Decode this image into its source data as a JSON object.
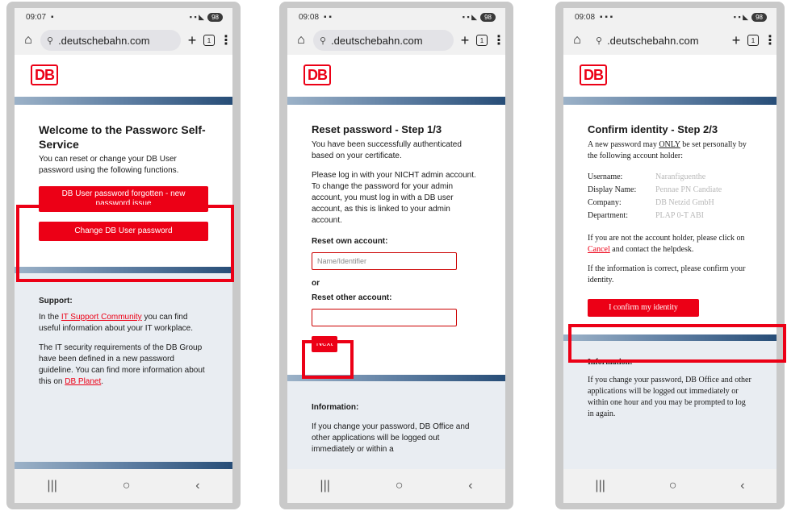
{
  "colors": {
    "brand_red": "#ec0016",
    "band_dark": "#274d77",
    "panel_grey": "#e9edf2"
  },
  "phones": [
    {
      "status": {
        "time": "09:07",
        "battery": "98"
      },
      "url": ".deutschebahn.com",
      "tab_count": "1",
      "title": "Welcome to the Passworc Self-Service",
      "intro": "You can reset or change your DB User password using the following functions.",
      "btn_forgot": "DB User password forgotten - new password issue",
      "btn_change": "Change DB User password",
      "support_title": "Support:",
      "support_p1_pre": "In the ",
      "support_p1_link": "IT Support Community",
      "support_p1_post": " you can find useful information about your IT workplace.",
      "support_p2": "The IT security requirements of the DB Group have been defined in a new password guideline. You can find more information about this on",
      "support_p2_link": "DB Planet",
      "support_p2_end": "."
    },
    {
      "status": {
        "time": "09:08",
        "battery": "98"
      },
      "url": ".deutschebahn.com",
      "tab_count": "1",
      "title": "Reset password - Step 1/3",
      "p1": "You have been successfully authenticated based on your certificate.",
      "p2": "Please log in with your NICHT admin account. To change the password for your admin account, you must log in with a DB user account, as this is linked to your admin account.",
      "label_own": "Reset own account:",
      "placeholder_own": "Name/Identifier",
      "or": "or",
      "label_other": "Reset other account:",
      "btn_next": "Next",
      "info_title": "Information:",
      "info_text": "If you change your password, DB Office and other applications will be logged out immediately or within a"
    },
    {
      "status": {
        "time": "09:08",
        "battery": "98"
      },
      "url": ".deutschebahn.com",
      "tab_count": "1",
      "title": "Confirm identity - Step 2/3",
      "intro_pre": "A new password may ",
      "intro_only": "ONLY",
      "intro_post": " be set personally by the following account holder:",
      "fields": [
        {
          "label": "Username:",
          "value": "Naranfiguenthe"
        },
        {
          "label": "Display Name:",
          "value": "Pennae PN Candiate"
        },
        {
          "label": "Company:",
          "value": "DB Netzid GmbH"
        },
        {
          "label": "Department:",
          "value": "PLAP 0-T ABI"
        }
      ],
      "not_holder_pre": "If you are not the account holder, please click on ",
      "not_holder_link": "Cancel",
      "not_holder_post": " and contact the helpdesk.",
      "confirm_text": "If the information is correct, please confirm your identity.",
      "btn_confirm": "I confirm my identity",
      "info_title": "Information:",
      "info_text": "If you change your password, DB Office and other applications will be logged out immediately or within one hour and you may be prompted to log in again."
    }
  ],
  "nav": {
    "recents": "|||",
    "home": "○",
    "back": "‹"
  }
}
